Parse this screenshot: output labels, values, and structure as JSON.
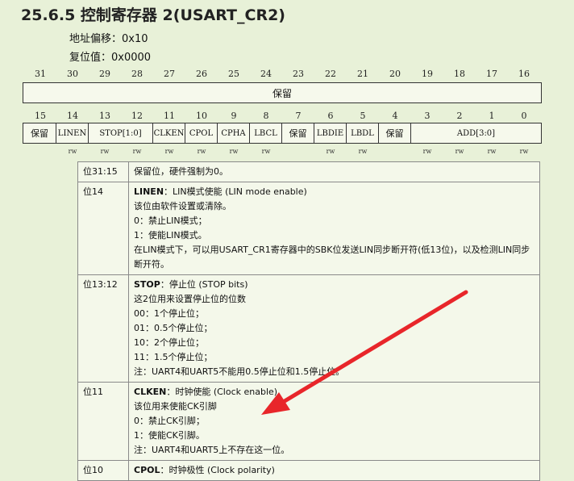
{
  "header": {
    "title": "25.6.5   控制寄存器 2(USART_CR2)",
    "address_offset": "地址偏移：0x10",
    "reset_value": "复位值：0x0000"
  },
  "bit_numbers_high": [
    "31",
    "30",
    "29",
    "28",
    "27",
    "26",
    "25",
    "24",
    "23",
    "22",
    "21",
    "20",
    "19",
    "18",
    "17",
    "16"
  ],
  "bit_numbers_low": [
    "15",
    "14",
    "13",
    "12",
    "11",
    "10",
    "9",
    "8",
    "7",
    "6",
    "5",
    "4",
    "3",
    "2",
    "1",
    "0"
  ],
  "reserved_high_label": "保留",
  "fields_low": [
    {
      "label": "保留"
    },
    {
      "label": "LINEN"
    },
    {
      "label": "STOP[1:0]"
    },
    {
      "label": "CLKEN"
    },
    {
      "label": "CPOL"
    },
    {
      "label": "CPHA"
    },
    {
      "label": "LBCL"
    },
    {
      "label": "保留"
    },
    {
      "label": "LBDIE"
    },
    {
      "label": "LBDL"
    },
    {
      "label": "保留"
    },
    {
      "label": "ADD[3:0]"
    }
  ],
  "access_label": "rw",
  "descriptions": [
    {
      "bits": "位31:15",
      "lines": [
        "保留位，硬件强制为0。"
      ]
    },
    {
      "bits": "位14",
      "name": "LINEN",
      "name_desc": "：LIN模式使能 (LIN mode enable)",
      "lines": [
        "该位由软件设置或清除。",
        "0：禁止LIN模式；",
        "1：使能LIN模式。",
        "在LIN模式下，可以用USART_CR1寄存器中的SBK位发送LIN同步断开符(低13位)，以及检测LIN同步断开符。"
      ]
    },
    {
      "bits": "位13:12",
      "name": "STOP",
      "name_desc": "：停止位 (STOP bits)",
      "lines": [
        "这2位用来设置停止位的位数",
        "00：1个停止位；",
        "01：0.5个停止位；",
        "10：2个停止位；",
        "11：1.5个停止位；",
        "注：UART4和UART5不能用0.5停止位和1.5停止位。"
      ]
    },
    {
      "bits": "位11",
      "name": "CLKEN",
      "name_desc": "：时钟使能 (Clock enable)",
      "lines": [
        "该位用来使能CK引脚",
        "0：禁止CK引脚；",
        "1：使能CK引脚。",
        "注：UART4和UART5上不存在这一位。"
      ]
    },
    {
      "bits": "位10",
      "name": "CPOL",
      "name_desc": "：时钟极性 (Clock polarity)",
      "lines": []
    }
  ]
}
